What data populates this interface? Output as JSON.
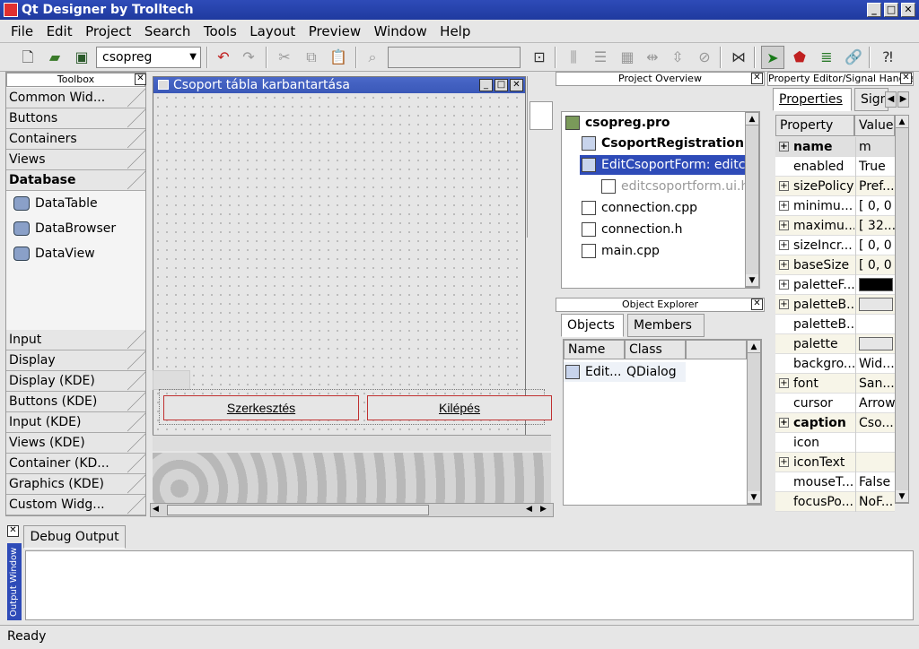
{
  "window": {
    "title": "Qt Designer by Trolltech",
    "min": "_",
    "max": "□",
    "close": "✕"
  },
  "menu": [
    "File",
    "Edit",
    "Project",
    "Search",
    "Tools",
    "Layout",
    "Preview",
    "Window",
    "Help"
  ],
  "toolbar": {
    "project_combo": "csopreg"
  },
  "toolbox": {
    "title": "Toolbox",
    "top_categories": [
      "Common Wid...",
      "Buttons",
      "Containers",
      "Views",
      "Database"
    ],
    "tools": [
      "DataTable",
      "DataBrowser",
      "DataView"
    ],
    "bottom_categories": [
      "Input",
      "Display",
      "Display (KDE)",
      "Buttons (KDE)",
      "Input (KDE)",
      "Views (KDE)",
      "Container (KD...",
      "Graphics (KDE)",
      "Custom Widg..."
    ]
  },
  "form": {
    "title": "Csoport tábla karbantartása",
    "button1": "Szerkesztés",
    "button2": "Kilépés"
  },
  "project_overview": {
    "title": "Project Overview",
    "items": [
      "csopreg.pro",
      "CsoportRegistrationF...",
      "EditCsoportForm: editc...",
      "editcsoportform.ui.h",
      "connection.cpp",
      "connection.h",
      "main.cpp"
    ]
  },
  "object_explorer": {
    "title": "Object Explorer",
    "tabs": [
      "Objects",
      "Members"
    ],
    "columns": [
      "Name",
      "Class"
    ],
    "row": {
      "name": "Edit...",
      "class": "QDialog"
    }
  },
  "property_editor": {
    "title": "Property Editor/Signal Handlers",
    "tabs": [
      "Properties",
      "Signal"
    ],
    "columns": [
      "Property",
      "Value"
    ],
    "rows": [
      {
        "name": "name",
        "value": "m",
        "bold": true,
        "expand": true
      },
      {
        "name": "enabled",
        "value": "True"
      },
      {
        "name": "sizePolicy",
        "value": "Pref...",
        "expand": true
      },
      {
        "name": "minimu...",
        "value": "[ 0, 0 ]",
        "expand": true
      },
      {
        "name": "maximu...",
        "value": "[ 32...",
        "expand": true
      },
      {
        "name": "sizeIncr...",
        "value": "[ 0, 0 ]",
        "expand": true
      },
      {
        "name": "baseSize",
        "value": "[ 0, 0 ]",
        "expand": true
      },
      {
        "name": "paletteF...",
        "value": "",
        "expand": true,
        "swatch": "#000000"
      },
      {
        "name": "paletteB...",
        "value": "",
        "expand": true,
        "swatch": "#e6e6e6"
      },
      {
        "name": "paletteB...",
        "value": ""
      },
      {
        "name": "palette",
        "value": "",
        "swatch": "#e6e6e6"
      },
      {
        "name": "backgro...",
        "value": "Wid..."
      },
      {
        "name": "font",
        "value": "San...",
        "expand": true
      },
      {
        "name": "cursor",
        "value": "Arrow"
      },
      {
        "name": "caption",
        "value": "Cso...",
        "bold": true,
        "expand": true
      },
      {
        "name": "icon",
        "value": ""
      },
      {
        "name": "iconText",
        "value": "",
        "expand": true
      },
      {
        "name": "mouseT...",
        "value": "False"
      },
      {
        "name": "focusPo...",
        "value": "NoF..."
      }
    ]
  },
  "output": {
    "side_title": "Output Window",
    "tab": "Debug Output"
  },
  "status": "Ready"
}
